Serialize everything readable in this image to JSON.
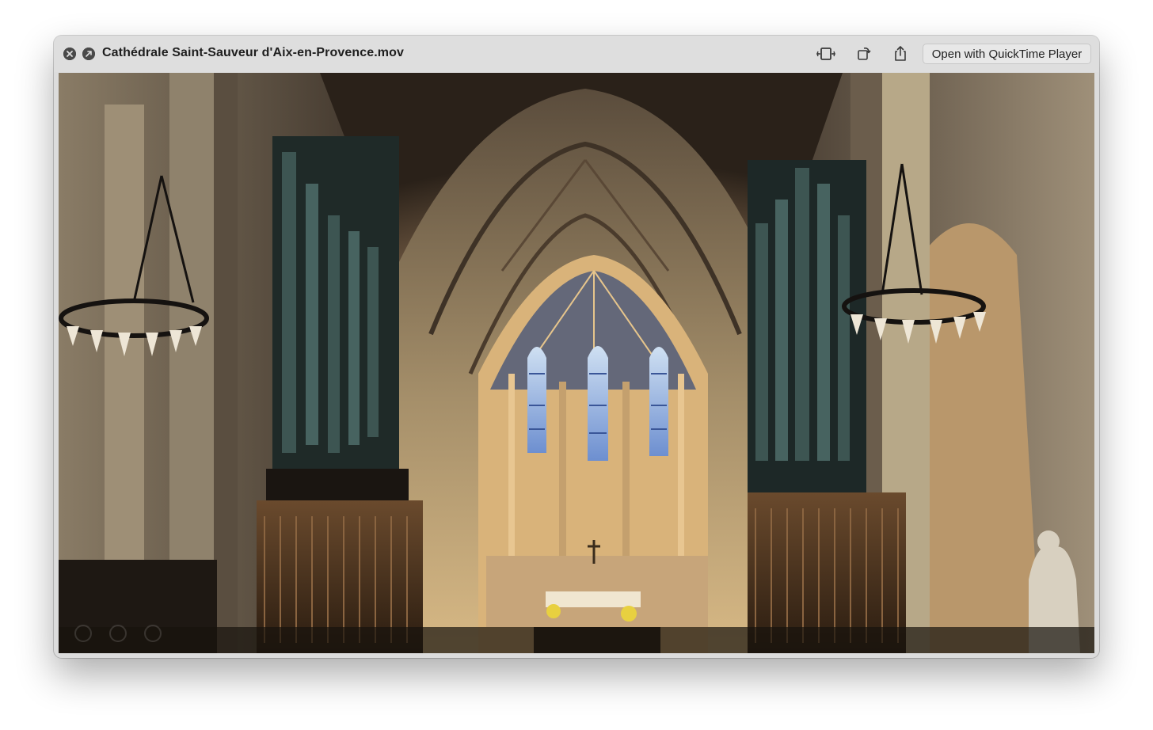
{
  "window": {
    "title": "Cathédrale Saint-Sauveur d'Aix-en-Provence.mov",
    "open_button_label": "Open with QuickTime Player"
  },
  "titlebar_icons": {
    "close": "close-icon",
    "share_circle": "share-circle-icon",
    "trim": "trim-icon",
    "rotate": "rotate-icon",
    "share": "share-icon"
  },
  "video": {
    "scene": "cathedral-interior-photo",
    "playback_controls": [
      "skip-back-icon",
      "play-icon",
      "skip-forward-icon"
    ]
  },
  "colors": {
    "titlebar": "#dedede",
    "title_text": "#1e1e1e"
  }
}
